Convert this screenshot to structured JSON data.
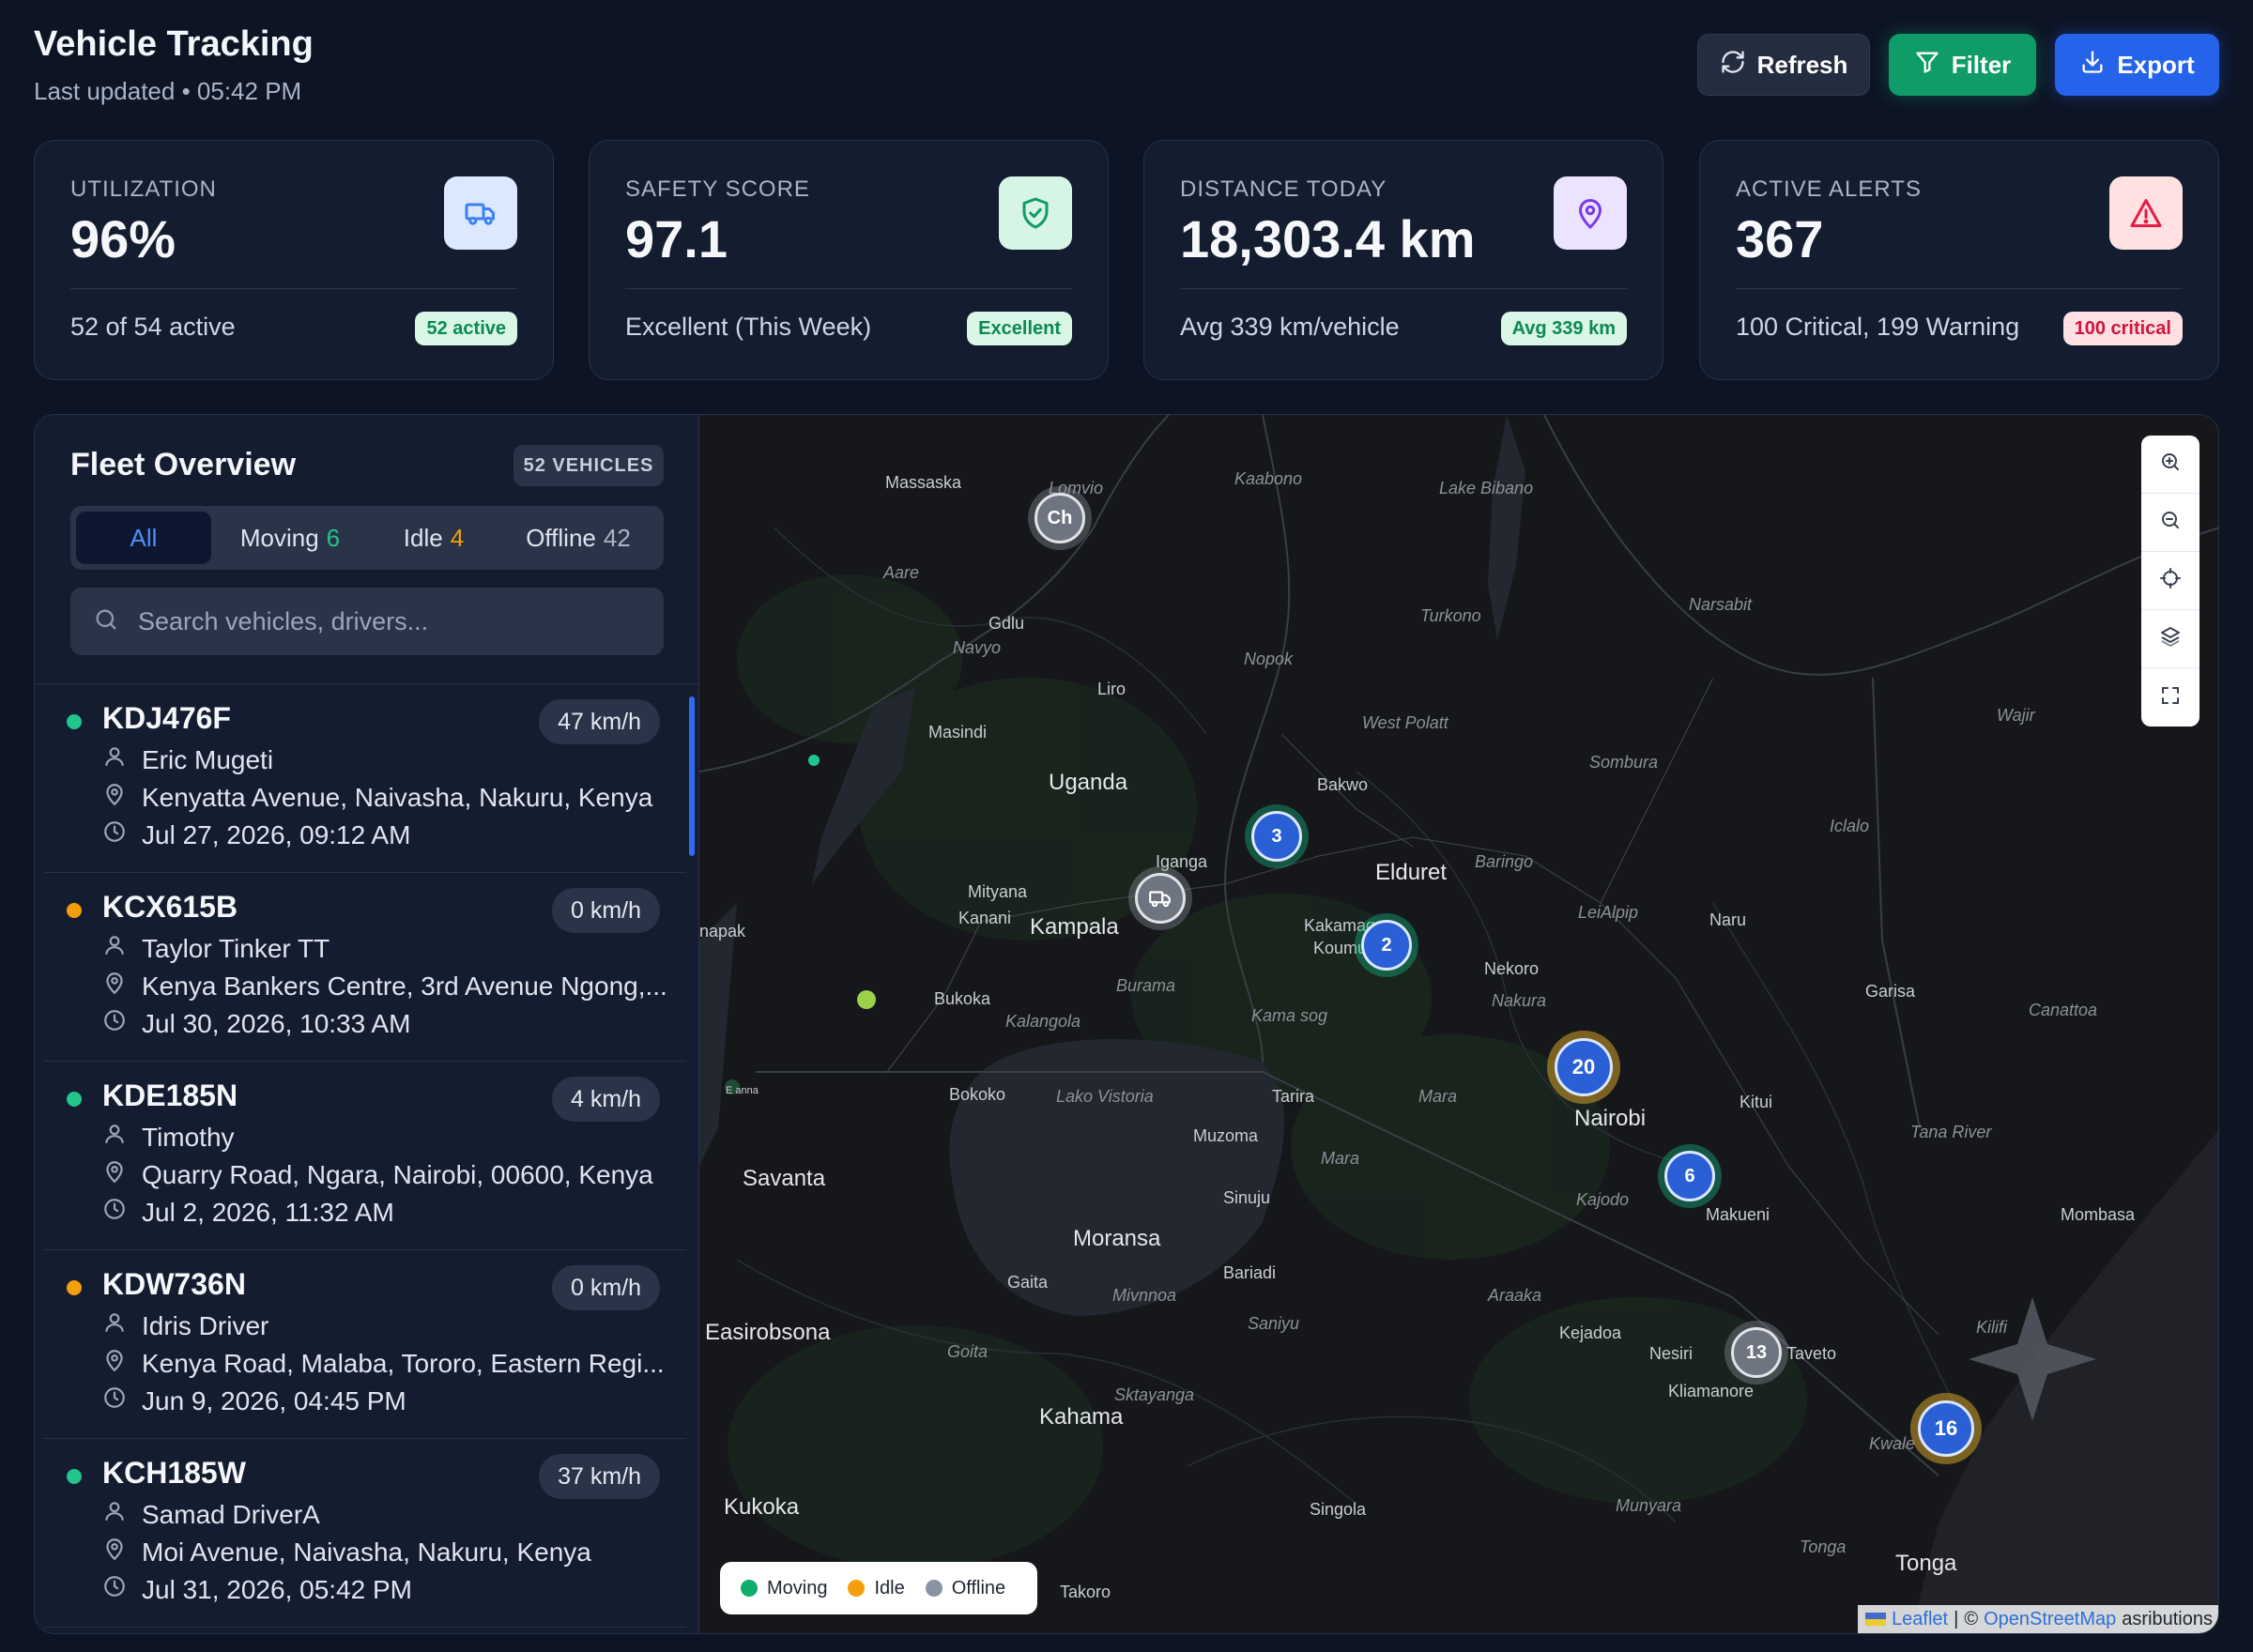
{
  "header": {
    "title": "Vehicle Tracking",
    "subtitle": "Last updated • 05:42 PM",
    "buttons": {
      "refresh": "Refresh",
      "filter": "Filter",
      "export": "Export"
    }
  },
  "stats": [
    {
      "label": "UTILIZATION",
      "value": "96%",
      "footer": "52 of 54 active",
      "badge": "52 active",
      "icon": "truck-icon",
      "accent": "#3b82f6"
    },
    {
      "label": "SAFETY SCORE",
      "value": "97.1",
      "footer": "Excellent (This Week)",
      "badge": "Excellent",
      "icon": "shield-check-icon",
      "accent": "#10b981"
    },
    {
      "label": "DISTANCE TODAY",
      "value": "18,303.4 km",
      "footer": "Avg 339 km/vehicle",
      "badge": "Avg 339 km",
      "icon": "map-pin-icon",
      "accent": "#7c3aed"
    },
    {
      "label": "ACTIVE ALERTS",
      "value": "367",
      "footer": "100 Critical, 199 Warning",
      "badge": "100 critical",
      "icon": "alert-triangle-icon",
      "accent": "#ef4444"
    }
  ],
  "fleet": {
    "title": "Fleet Overview",
    "count": "52 VEHICLES",
    "tabs": {
      "all": "All",
      "moving": "Moving",
      "moving_count": "6",
      "idle": "Idle",
      "idle_count": "4",
      "offline": "Offline",
      "offline_count": "42"
    },
    "search_placeholder": "Search vehicles, drivers...",
    "vehicles": [
      {
        "plate": "KDJ476F",
        "speed": "47 km/h",
        "status": "moving",
        "driver": "Eric Mugeti",
        "location": "Kenyatta Avenue, Naivasha, Nakuru, Kenya",
        "time": "Jul 27, 2026, 09:12 AM"
      },
      {
        "plate": "KCX615B",
        "speed": "0 km/h",
        "status": "idle",
        "driver": "Taylor Tinker TT",
        "location": "Kenya Bankers Centre, 3rd Avenue Ngong,...",
        "time": "Jul 30, 2026, 10:33 AM"
      },
      {
        "plate": "KDE185N",
        "speed": "4 km/h",
        "status": "moving",
        "driver": "Timothy",
        "location": "Quarry Road, Ngara, Nairobi, 00600, Kenya",
        "time": "Jul 2, 2026, 11:32 AM"
      },
      {
        "plate": "KDW736N",
        "speed": "0 km/h",
        "status": "idle",
        "driver": "Idris Driver",
        "location": "Kenya Road, Malaba, Tororo, Eastern Regi...",
        "time": "Jun 9, 2026, 04:45 PM"
      },
      {
        "plate": "KCH185W",
        "speed": "37 km/h",
        "status": "moving",
        "driver": "Samad DriverA",
        "location": "Moi Avenue, Naivasha, Nakuru, Kenya",
        "time": "Jul 31, 2026, 05:42 PM"
      }
    ]
  },
  "status_colors": {
    "moving": "#22c58b",
    "idle": "#f59e0b",
    "offline": "#8a93a3"
  },
  "map": {
    "labels": [
      {
        "text": "Massaska"
      },
      {
        "text": "Lomvio"
      },
      {
        "text": "Kaabono"
      },
      {
        "text": "Lake Bibano"
      },
      {
        "text": "Aare"
      },
      {
        "text": "Gdlu"
      },
      {
        "text": "Navyo"
      },
      {
        "text": "Turkono"
      },
      {
        "text": "Narsabit"
      },
      {
        "text": "Nopok"
      },
      {
        "text": "Liro"
      },
      {
        "text": "West Polatt"
      },
      {
        "text": "Masindi"
      },
      {
        "text": "Wajir"
      },
      {
        "text": "Sombura"
      },
      {
        "text": "Uganda"
      },
      {
        "text": "Bakwo"
      },
      {
        "text": "Iclalo"
      },
      {
        "text": "Iganga"
      },
      {
        "text": "Elduret"
      },
      {
        "text": "Baringo"
      },
      {
        "text": "Mityana"
      },
      {
        "text": "Kanani"
      },
      {
        "text": "Kampala"
      },
      {
        "text": "Kakamaga"
      },
      {
        "text": "Koumu..."
      },
      {
        "text": "LeiAlpip"
      },
      {
        "text": "Naru"
      },
      {
        "text": "napak"
      },
      {
        "text": "Nekoro"
      },
      {
        "text": "Nakura"
      },
      {
        "text": "Burama"
      },
      {
        "text": "Bukoka"
      },
      {
        "text": "Garisa"
      },
      {
        "text": "Canattoa"
      },
      {
        "text": "Kama sog"
      },
      {
        "text": "Kalangola"
      },
      {
        "text": "Bokoko"
      },
      {
        "text": "Lako Vistoria"
      },
      {
        "text": "Tarira"
      },
      {
        "text": "Mara"
      },
      {
        "text": "Nairobi"
      },
      {
        "text": "Kitui"
      },
      {
        "text": "Muzoma"
      },
      {
        "text": "Tana River"
      },
      {
        "text": "Savanta"
      },
      {
        "text": "Kajodo"
      },
      {
        "text": "Sinuju"
      },
      {
        "text": "Makueni"
      },
      {
        "text": "Mombasa"
      },
      {
        "text": "Moransa"
      },
      {
        "text": "Bariadi"
      },
      {
        "text": "Gaita"
      },
      {
        "text": "Mivnnoa"
      },
      {
        "text": "Araaka"
      },
      {
        "text": "Saniyu"
      },
      {
        "text": "Kilifi"
      },
      {
        "text": "Easirobsona"
      },
      {
        "text": "Goita"
      },
      {
        "text": "Kejadoa"
      },
      {
        "text": "Nesiri"
      },
      {
        "text": "Taveto"
      },
      {
        "text": "Kliamanore"
      },
      {
        "text": "Sktayanga"
      },
      {
        "text": "Kahama"
      },
      {
        "text": "Kwale"
      },
      {
        "text": "Kukoka"
      },
      {
        "text": "Singola"
      },
      {
        "text": "Munyara"
      },
      {
        "text": "Tonga"
      },
      {
        "text": "Tonga"
      },
      {
        "text": "Takoro"
      },
      {
        "text": "E anna"
      },
      {
        "text": "Mara"
      }
    ],
    "clusters": [
      {
        "label": "Ch",
        "kind": "gray"
      },
      {
        "label": "3",
        "kind": "green"
      },
      {
        "label": "2",
        "kind": "green"
      },
      {
        "label": "20",
        "kind": "gold"
      },
      {
        "label": "6",
        "kind": "green"
      },
      {
        "label": "13",
        "kind": "gray"
      },
      {
        "label": "16",
        "kind": "gold"
      }
    ],
    "legend": {
      "moving": "Moving",
      "idle": "Idle",
      "offline": "Offline"
    },
    "attribution": {
      "leaflet": "Leaflet",
      "sep": "|",
      "copy": "©",
      "osm": "OpenStreetMap",
      "rest": "asributions"
    }
  }
}
